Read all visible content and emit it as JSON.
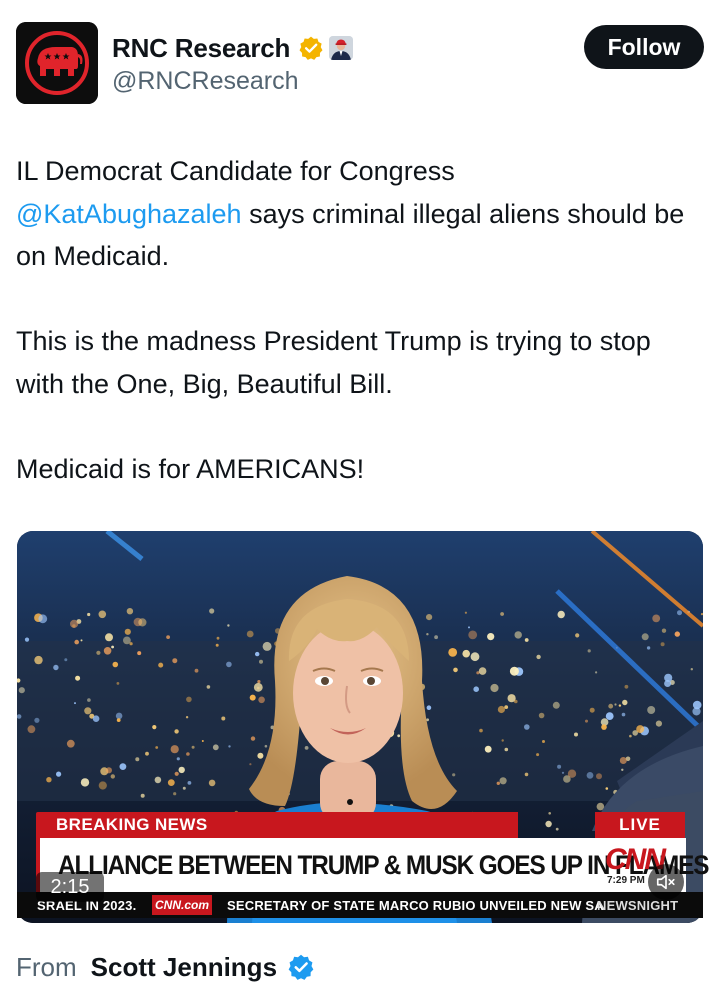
{
  "author": {
    "display_name": "RNC Research",
    "handle": "@RNCResearch",
    "avatar_icon": "elephant-logo-icon",
    "verified_badge": "gold-check-icon",
    "affiliate_badge": "affiliate-portrait-icon"
  },
  "follow_label": "Follow",
  "tweet": {
    "p1_text1": "IL Democrat Candidate for Congress",
    "p1_mention": "@KatAbughazaleh",
    "p1_text2": " says criminal illegal aliens should be on Medicaid.",
    "p2": "This is the madness President Trump is trying to stop with the One, Big, Beautiful Bill.",
    "p3": "Medicaid is for AMERICANS!"
  },
  "video": {
    "duration": "2:15",
    "mute_icon": "speaker-muted-icon",
    "lower_third": {
      "breaking": "BREAKING NEWS",
      "live": "LIVE",
      "headline": "ALLIANCE BETWEEN TRUMP & MUSK GOES UP IN FLAMES",
      "network_logo": "CNN",
      "time": "7:29 PM",
      "ticker_left": "SRAEL IN 2023.",
      "ticker_site": "CNN.com",
      "ticker_main": "SECRETARY OF STATE MARCO RUBIO UNVEILED NEW SA",
      "ticker_show": "NEWSNIGHT"
    }
  },
  "source": {
    "label": "From",
    "name": "Scott Jennings",
    "badge": "blue-check-icon"
  },
  "colors": {
    "link": "#1d9bf0",
    "secondary_text": "#536471",
    "cnn_red": "#c8171e",
    "verified_gold": "#f4b400",
    "verified_blue": "#1d9bf0"
  }
}
